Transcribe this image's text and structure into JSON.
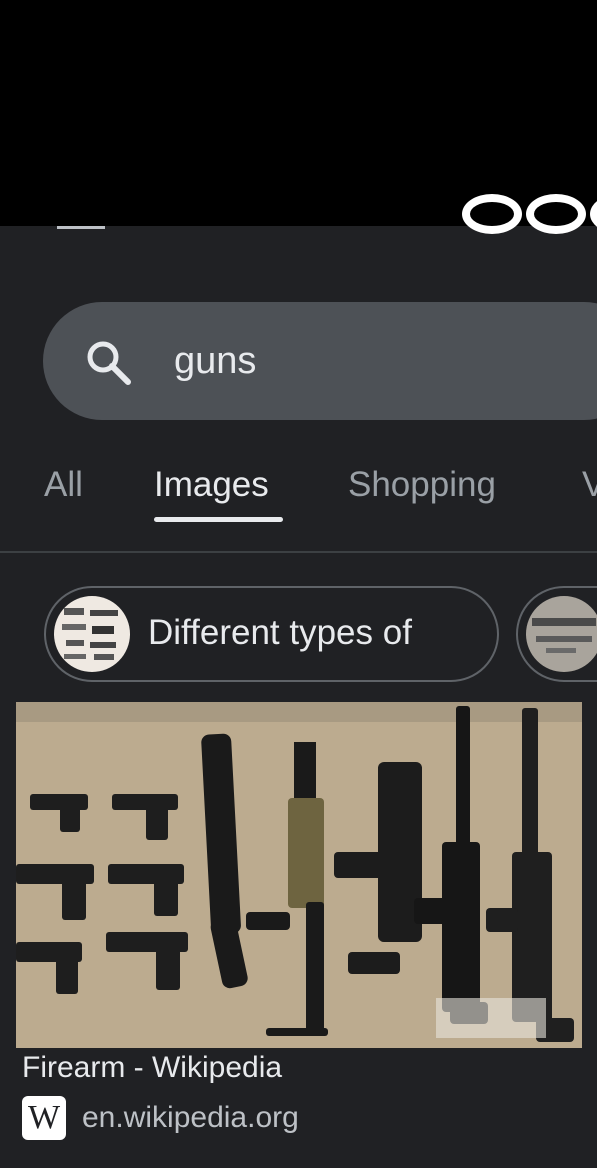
{
  "search": {
    "query": "guns"
  },
  "tabs": [
    {
      "label": "All",
      "active": false
    },
    {
      "label": "Images",
      "active": true
    },
    {
      "label": "Shopping",
      "active": false
    },
    {
      "label": "V",
      "active": false
    }
  ],
  "chips": [
    {
      "label": "Different types of"
    },
    {
      "label": ""
    }
  ],
  "result": {
    "title": "Firearm - Wikipedia",
    "favicon_letter": "W",
    "domain": "en.wikipedia.org"
  },
  "colors": {
    "background": "#202124",
    "search_bar": "#4d5156",
    "text_primary": "#e8eaed",
    "text_secondary": "#9aa0a6",
    "redaction": "#000000"
  },
  "icons": {
    "search": "search-icon",
    "site": "wikipedia-w-icon"
  }
}
